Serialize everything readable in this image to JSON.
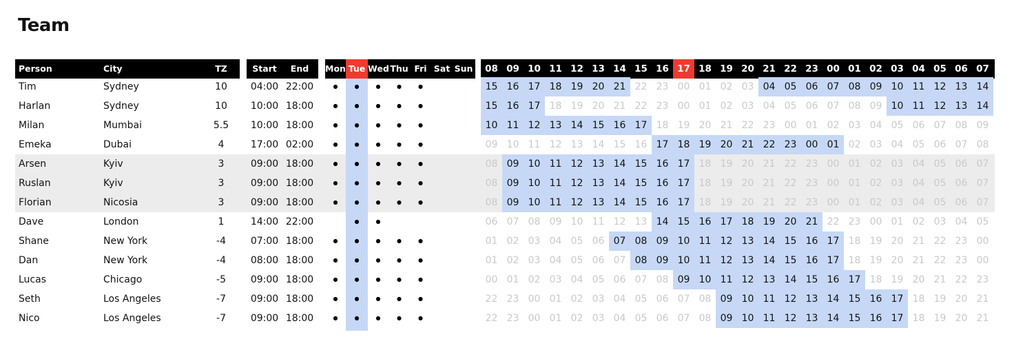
{
  "title": "Team",
  "headers": {
    "person": "Person",
    "city": "City",
    "tz": "TZ",
    "start": "Start",
    "end": "End",
    "days": [
      "Mon",
      "Tue",
      "Wed",
      "Thu",
      "Fri",
      "Sat",
      "Sun"
    ],
    "hours": [
      "08",
      "09",
      "10",
      "11",
      "12",
      "13",
      "14",
      "15",
      "16",
      "17",
      "18",
      "19",
      "20",
      "21",
      "22",
      "23",
      "00",
      "01",
      "02",
      "03",
      "04",
      "05",
      "06",
      "07"
    ]
  },
  "highlight": {
    "day": "Tue",
    "hour": "17"
  },
  "colors": {
    "header_bg": "#000000",
    "highlight_red": "#ee3b30",
    "work_blue": "#c6d8f6",
    "row_gray": "#ececec",
    "off_text": "#c9c9c9"
  },
  "rows": [
    {
      "person": "Tim",
      "city": "Sydney",
      "tz": "10",
      "start": "04:00",
      "end": "22:00",
      "days": [
        1,
        1,
        1,
        1,
        1,
        0,
        0
      ],
      "hours": [
        "15",
        "16",
        "17",
        "18",
        "19",
        "20",
        "21",
        "22",
        "23",
        "00",
        "01",
        "02",
        "03",
        "04",
        "05",
        "06",
        "07",
        "08",
        "09",
        "10",
        "11",
        "12",
        "13",
        "14"
      ],
      "work": [
        1,
        1,
        1,
        1,
        1,
        1,
        1,
        0,
        0,
        0,
        0,
        0,
        0,
        1,
        1,
        1,
        1,
        1,
        1,
        1,
        1,
        1,
        1,
        1
      ],
      "gray": false
    },
    {
      "person": "Harlan",
      "city": "Sydney",
      "tz": "10",
      "start": "10:00",
      "end": "18:00",
      "days": [
        1,
        1,
        1,
        1,
        1,
        0,
        0
      ],
      "hours": [
        "15",
        "16",
        "17",
        "18",
        "19",
        "20",
        "21",
        "22",
        "23",
        "00",
        "01",
        "02",
        "03",
        "04",
        "05",
        "06",
        "07",
        "08",
        "09",
        "10",
        "11",
        "12",
        "13",
        "14"
      ],
      "work": [
        1,
        1,
        1,
        0,
        0,
        0,
        0,
        0,
        0,
        0,
        0,
        0,
        0,
        0,
        0,
        0,
        0,
        0,
        0,
        1,
        1,
        1,
        1,
        1
      ],
      "gray": false
    },
    {
      "person": "Milan",
      "city": "Mumbai",
      "tz": "5.5",
      "start": "10:00",
      "end": "18:00",
      "days": [
        1,
        1,
        1,
        1,
        1,
        0,
        0
      ],
      "hours": [
        "10",
        "11",
        "12",
        "13",
        "14",
        "15",
        "16",
        "17",
        "18",
        "19",
        "20",
        "21",
        "22",
        "23",
        "00",
        "01",
        "02",
        "03",
        "04",
        "05",
        "06",
        "07",
        "08",
        "09"
      ],
      "work": [
        1,
        1,
        1,
        1,
        1,
        1,
        1,
        1,
        0,
        0,
        0,
        0,
        0,
        0,
        0,
        0,
        0,
        0,
        0,
        0,
        0,
        0,
        0,
        0
      ],
      "gray": false
    },
    {
      "person": "Emeka",
      "city": "Dubai",
      "tz": "4",
      "start": "17:00",
      "end": "02:00",
      "days": [
        1,
        1,
        1,
        1,
        1,
        0,
        0
      ],
      "hours": [
        "09",
        "10",
        "11",
        "12",
        "13",
        "14",
        "15",
        "16",
        "17",
        "18",
        "19",
        "20",
        "21",
        "22",
        "23",
        "00",
        "01",
        "02",
        "03",
        "04",
        "05",
        "06",
        "07",
        "08"
      ],
      "work": [
        0,
        0,
        0,
        0,
        0,
        0,
        0,
        0,
        1,
        1,
        1,
        1,
        1,
        1,
        1,
        1,
        1,
        0,
        0,
        0,
        0,
        0,
        0,
        0
      ],
      "gray": false
    },
    {
      "person": "Arsen",
      "city": "Kyiv",
      "tz": "3",
      "start": "09:00",
      "end": "18:00",
      "days": [
        1,
        1,
        1,
        1,
        1,
        0,
        0
      ],
      "hours": [
        "08",
        "09",
        "10",
        "11",
        "12",
        "13",
        "14",
        "15",
        "16",
        "17",
        "18",
        "19",
        "20",
        "21",
        "22",
        "23",
        "00",
        "01",
        "02",
        "03",
        "04",
        "05",
        "06",
        "07"
      ],
      "work": [
        0,
        1,
        1,
        1,
        1,
        1,
        1,
        1,
        1,
        1,
        0,
        0,
        0,
        0,
        0,
        0,
        0,
        0,
        0,
        0,
        0,
        0,
        0,
        0
      ],
      "gray": true
    },
    {
      "person": "Ruslan",
      "city": "Kyiv",
      "tz": "3",
      "start": "09:00",
      "end": "18:00",
      "days": [
        1,
        1,
        1,
        1,
        1,
        0,
        0
      ],
      "hours": [
        "08",
        "09",
        "10",
        "11",
        "12",
        "13",
        "14",
        "15",
        "16",
        "17",
        "18",
        "19",
        "20",
        "21",
        "22",
        "23",
        "00",
        "01",
        "02",
        "03",
        "04",
        "05",
        "06",
        "07"
      ],
      "work": [
        0,
        1,
        1,
        1,
        1,
        1,
        1,
        1,
        1,
        1,
        0,
        0,
        0,
        0,
        0,
        0,
        0,
        0,
        0,
        0,
        0,
        0,
        0,
        0
      ],
      "gray": true
    },
    {
      "person": "Florian",
      "city": "Nicosia",
      "tz": "3",
      "start": "09:00",
      "end": "18:00",
      "days": [
        1,
        1,
        1,
        1,
        1,
        0,
        0
      ],
      "hours": [
        "08",
        "09",
        "10",
        "11",
        "12",
        "13",
        "14",
        "15",
        "16",
        "17",
        "18",
        "19",
        "20",
        "21",
        "22",
        "23",
        "00",
        "01",
        "02",
        "03",
        "04",
        "05",
        "06",
        "07"
      ],
      "work": [
        0,
        1,
        1,
        1,
        1,
        1,
        1,
        1,
        1,
        1,
        0,
        0,
        0,
        0,
        0,
        0,
        0,
        0,
        0,
        0,
        0,
        0,
        0,
        0
      ],
      "gray": true
    },
    {
      "person": "Dave",
      "city": "London",
      "tz": "1",
      "start": "14:00",
      "end": "22:00",
      "days": [
        0,
        1,
        1,
        0,
        0,
        0,
        0
      ],
      "hours": [
        "06",
        "07",
        "08",
        "09",
        "10",
        "11",
        "12",
        "13",
        "14",
        "15",
        "16",
        "17",
        "18",
        "19",
        "20",
        "21",
        "22",
        "23",
        "00",
        "01",
        "02",
        "03",
        "04",
        "05"
      ],
      "work": [
        0,
        0,
        0,
        0,
        0,
        0,
        0,
        0,
        1,
        1,
        1,
        1,
        1,
        1,
        1,
        1,
        0,
        0,
        0,
        0,
        0,
        0,
        0,
        0
      ],
      "gray": false
    },
    {
      "person": "Shane",
      "city": "New York",
      "tz": "-4",
      "start": "07:00",
      "end": "18:00",
      "days": [
        1,
        1,
        1,
        1,
        1,
        0,
        0
      ],
      "hours": [
        "01",
        "02",
        "03",
        "04",
        "05",
        "06",
        "07",
        "08",
        "09",
        "10",
        "11",
        "12",
        "13",
        "14",
        "15",
        "16",
        "17",
        "18",
        "19",
        "20",
        "21",
        "22",
        "23",
        "00"
      ],
      "work": [
        0,
        0,
        0,
        0,
        0,
        0,
        1,
        1,
        1,
        1,
        1,
        1,
        1,
        1,
        1,
        1,
        1,
        0,
        0,
        0,
        0,
        0,
        0,
        0
      ],
      "gray": false
    },
    {
      "person": "Dan",
      "city": "New York",
      "tz": "-4",
      "start": "08:00",
      "end": "18:00",
      "days": [
        1,
        1,
        1,
        1,
        1,
        0,
        0
      ],
      "hours": [
        "01",
        "02",
        "03",
        "04",
        "05",
        "06",
        "07",
        "08",
        "09",
        "10",
        "11",
        "12",
        "13",
        "14",
        "15",
        "16",
        "17",
        "18",
        "19",
        "20",
        "21",
        "22",
        "23",
        "00"
      ],
      "work": [
        0,
        0,
        0,
        0,
        0,
        0,
        0,
        1,
        1,
        1,
        1,
        1,
        1,
        1,
        1,
        1,
        1,
        0,
        0,
        0,
        0,
        0,
        0,
        0
      ],
      "gray": false
    },
    {
      "person": "Lucas",
      "city": "Chicago",
      "tz": "-5",
      "start": "09:00",
      "end": "18:00",
      "days": [
        1,
        1,
        1,
        1,
        1,
        0,
        0
      ],
      "hours": [
        "00",
        "01",
        "02",
        "03",
        "04",
        "05",
        "06",
        "07",
        "08",
        "09",
        "10",
        "11",
        "12",
        "13",
        "14",
        "15",
        "16",
        "17",
        "18",
        "19",
        "20",
        "21",
        "22",
        "23"
      ],
      "work": [
        0,
        0,
        0,
        0,
        0,
        0,
        0,
        0,
        0,
        1,
        1,
        1,
        1,
        1,
        1,
        1,
        1,
        1,
        0,
        0,
        0,
        0,
        0,
        0
      ],
      "gray": false
    },
    {
      "person": "Seth",
      "city": "Los Angeles",
      "tz": "-7",
      "start": "09:00",
      "end": "18:00",
      "days": [
        1,
        1,
        1,
        1,
        1,
        0,
        0
      ],
      "hours": [
        "22",
        "23",
        "00",
        "01",
        "02",
        "03",
        "04",
        "05",
        "06",
        "07",
        "08",
        "09",
        "10",
        "11",
        "12",
        "13",
        "14",
        "15",
        "16",
        "17",
        "18",
        "19",
        "20",
        "21"
      ],
      "work": [
        0,
        0,
        0,
        0,
        0,
        0,
        0,
        0,
        0,
        0,
        0,
        1,
        1,
        1,
        1,
        1,
        1,
        1,
        1,
        1,
        0,
        0,
        0,
        0
      ],
      "gray": false
    },
    {
      "person": "Nico",
      "city": "Los Angeles",
      "tz": "-7",
      "start": "09:00",
      "end": "18:00",
      "days": [
        1,
        1,
        1,
        1,
        1,
        0,
        0
      ],
      "hours": [
        "22",
        "23",
        "00",
        "01",
        "02",
        "03",
        "04",
        "05",
        "06",
        "07",
        "08",
        "09",
        "10",
        "11",
        "12",
        "13",
        "14",
        "15",
        "16",
        "17",
        "18",
        "19",
        "20",
        "21"
      ],
      "work": [
        0,
        0,
        0,
        0,
        0,
        0,
        0,
        0,
        0,
        0,
        0,
        1,
        1,
        1,
        1,
        1,
        1,
        1,
        1,
        1,
        0,
        0,
        0,
        0
      ],
      "gray": false
    }
  ]
}
